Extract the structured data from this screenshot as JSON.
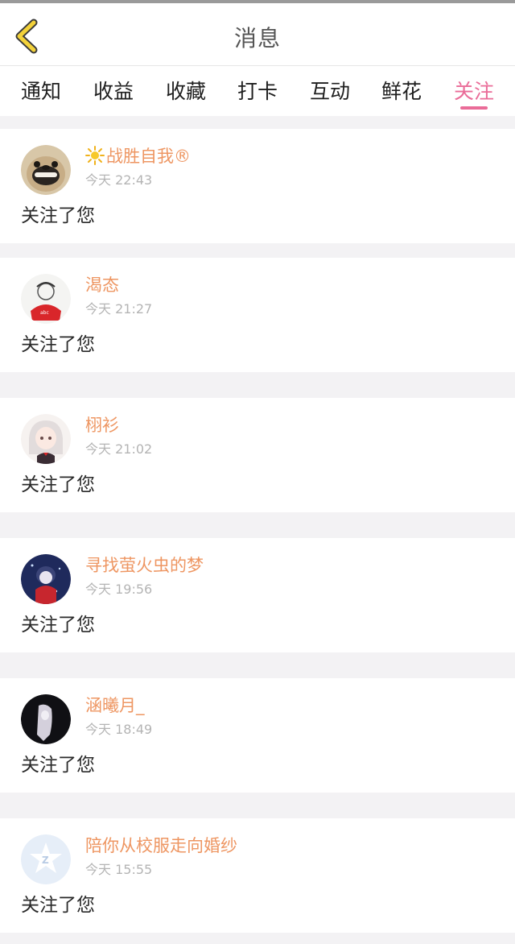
{
  "header": {
    "title": "消息"
  },
  "tabs": [
    {
      "label": "通知"
    },
    {
      "label": "收益"
    },
    {
      "label": "收藏"
    },
    {
      "label": "打卡"
    },
    {
      "label": "互动"
    },
    {
      "label": "鲜花"
    },
    {
      "label": "关注"
    }
  ],
  "active_tab": "关注",
  "colors": {
    "accent": "#ea6c98",
    "username": "#ee9662",
    "back_icon": "#f3d23a"
  },
  "messages": [
    {
      "name": "战胜自我®",
      "time": "今天 22:43",
      "text": "关注了您",
      "name_icon": "sun-icon"
    },
    {
      "name": "渴态",
      "time": "今天 21:27",
      "text": "关注了您"
    },
    {
      "name": "栩衫",
      "time": "今天 21:02",
      "text": "关注了您"
    },
    {
      "name": "寻找萤火虫的梦",
      "time": "今天 19:56",
      "text": "关注了您"
    },
    {
      "name": "涵曦月_",
      "time": "今天 18:49",
      "text": "关注了您"
    },
    {
      "name": "陪你从校服走向婚纱",
      "time": "今天 15:55",
      "text": "关注了您"
    }
  ]
}
